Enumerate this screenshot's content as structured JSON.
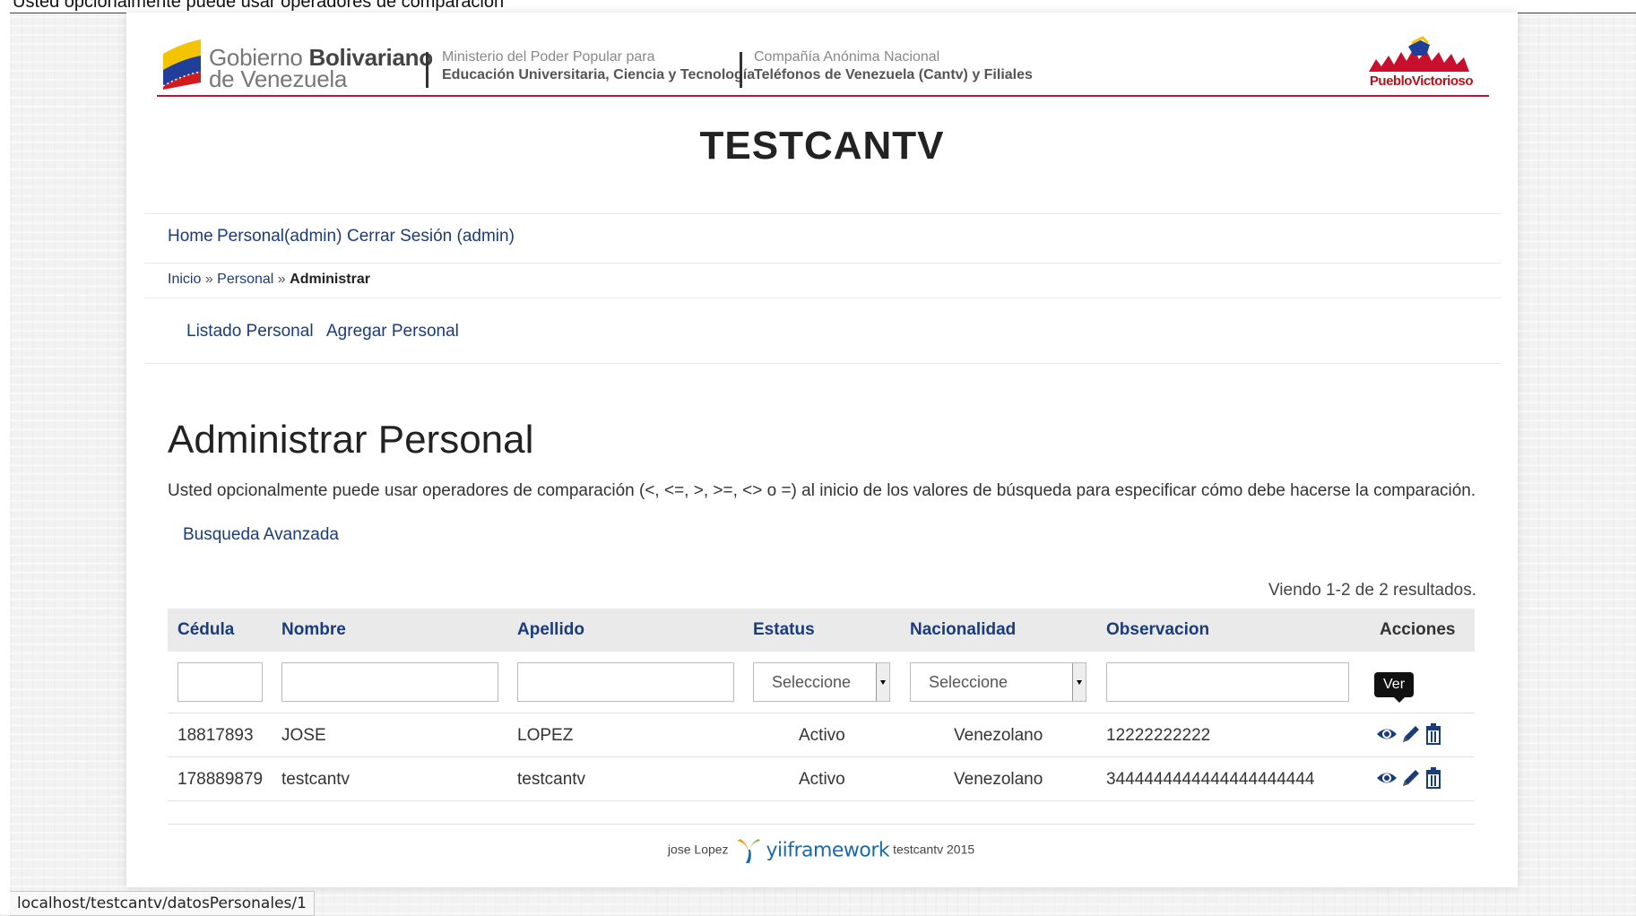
{
  "top_strip_text": "Usted opcionalmente puede usar operadores de comparación",
  "banner": {
    "gob_word1": "Gobierno",
    "gob_word2": "Bolivariano",
    "gob_line2": "de Venezuela",
    "ministerio_line1": "Ministerio del Poder Popular para",
    "ministerio_line2": "Educación Universitaria, Ciencia y Tecnología",
    "compania_line1": "Compañía  Anónima Nacional",
    "compania_line2": "Teléfonos de Venezuela (Cantv) y Filiales",
    "pueblo_text": "PuebloVictorioso"
  },
  "site_title": "TESTCANTV",
  "mainmenu": {
    "home": "Home",
    "personal": "Personal(admin)",
    "logout": "Cerrar Sesión (admin)"
  },
  "breadcrumbs": {
    "inicio": "Inicio",
    "sep": "»",
    "personal": "Personal",
    "current": "Administrar"
  },
  "submenu": {
    "listado": "Listado Personal",
    "agregar": "Agregar Personal"
  },
  "content": {
    "title": "Administrar Personal",
    "hint": "Usted opcionalmente puede usar operadores de comparación (<, <=, >, >=, <> o =) al inicio de los valores de búsqueda para especificar cómo debe hacerse la comparación.",
    "advanced_search": "Busqueda Avanzada",
    "summary": "Viendo 1-2 de 2 resultados."
  },
  "grid": {
    "columns": [
      "Cédula",
      "Nombre",
      "Apellido",
      "Estatus",
      "Nacionalidad",
      "Observacion",
      "Acciones"
    ],
    "filters": {
      "estatus_placeholder": "Seleccione",
      "nacionalidad_placeholder": "Seleccione"
    },
    "rows": [
      {
        "cedula": "18817893",
        "nombre": "JOSE",
        "apellido": "LOPEZ",
        "estatus": "Activo",
        "nacionalidad": "Venezolano",
        "observacion": "12222222222"
      },
      {
        "cedula": "178889879",
        "nombre": "testcantv",
        "apellido": "testcantv",
        "estatus": "Activo",
        "nacionalidad": "Venezolano",
        "observacion": "3444444444444444444444"
      }
    ],
    "tooltip": "Ver",
    "icons": {
      "view": "eye-icon",
      "edit": "pencil-icon",
      "delete": "trash-icon"
    }
  },
  "footer": {
    "author": "jose Lopez",
    "framework": "yiiframework",
    "suffix": "testcantv 2015"
  },
  "status_url": "localhost/testcantv/datosPersonales/1",
  "colors": {
    "link": "#1a3c7a",
    "banner_line": "#c8102e",
    "header_bg": "#eaeaea",
    "tooltip_bg": "#111111",
    "yii_blue": "#1b6aa6",
    "yii_orange": "#f39c12"
  }
}
